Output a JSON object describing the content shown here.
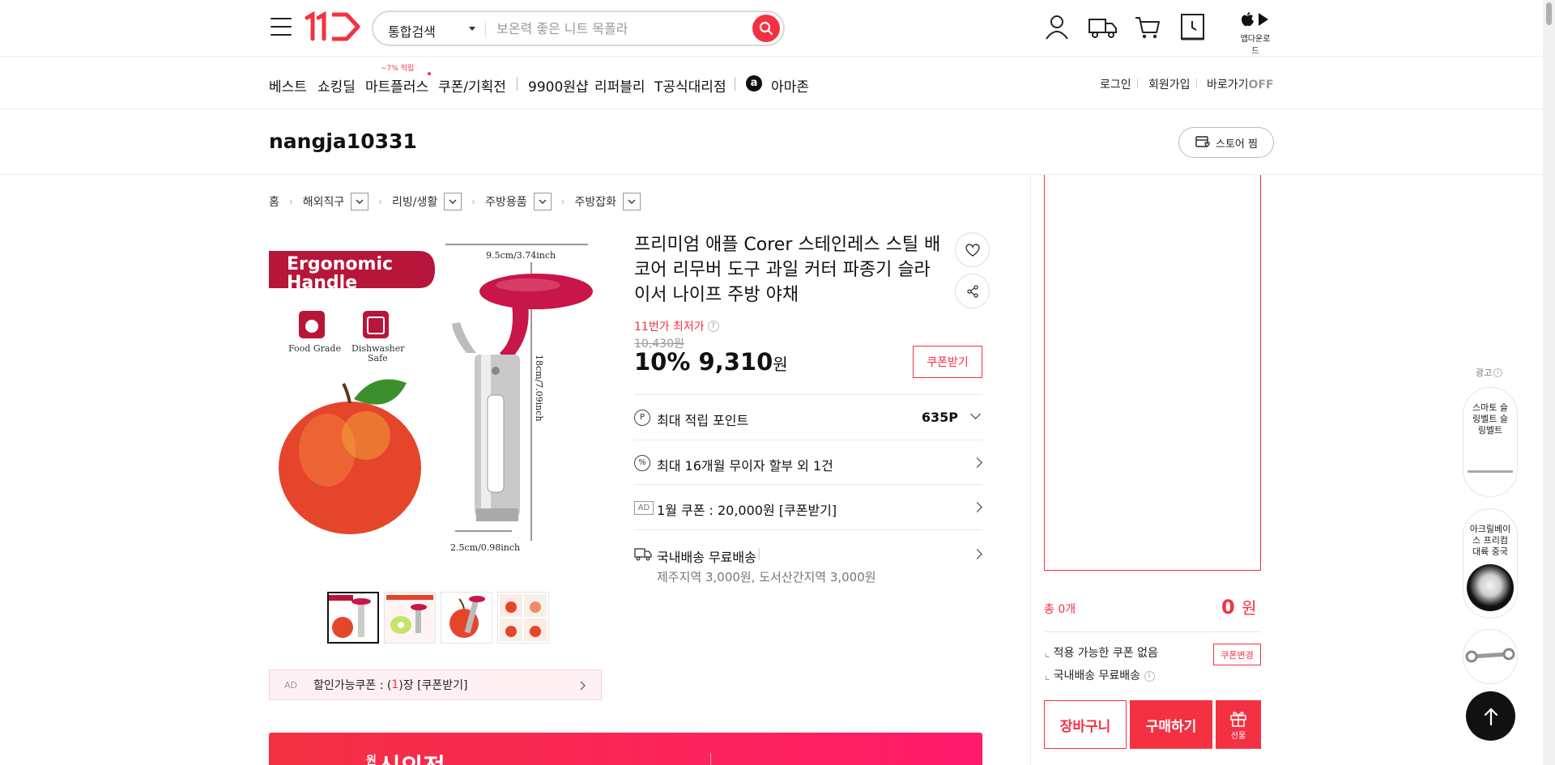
{
  "header": {
    "search_scope": "통합검색",
    "search_placeholder": "보온력 좋은 니트 목폴라",
    "app_download_label": "앱다운로드"
  },
  "nav": {
    "items": [
      "베스트",
      "쇼킹딜",
      "마트플러스",
      "쿠폰/기획전",
      "9900원샵",
      "리퍼블리",
      "T공식대리점",
      "아마존"
    ],
    "mart_badge": "~7% 적립",
    "right": {
      "login": "로그인",
      "signup": "회원가입",
      "shortcut": "바로가기",
      "shortcut_state": "OFF"
    }
  },
  "store": {
    "name": "nangja10331",
    "like_label": "스토어 찜"
  },
  "breadcrumb": [
    "홈",
    "해외직구",
    "리빙/생활",
    "주방용품",
    "주방잡화"
  ],
  "product": {
    "title": "프리미엄 애플 Corer 스테인레스 스틸 배 코어 리무버 도구 과일 커터 파종기 슬라이서 나이프 주방 야채",
    "lowest_label": "11번가 최저가",
    "original_price": "10,430원",
    "discount": "10%",
    "price": "9,310",
    "price_unit": "원",
    "coupon_button": "쿠폰받기",
    "image_text": {
      "headline_1": "Ergonomic",
      "headline_2": "Handle",
      "width": "9.5cm/3.74inch",
      "height": "18cm/7.09inch",
      "blade": "2.5cm/0.98inch",
      "food_grade": "Food Grade",
      "dishwasher_1": "Dishwasher",
      "dishwasher_2": "Safe"
    },
    "image_coupon": {
      "ad": "AD",
      "text_prefix": "할인가능쿠폰 : (",
      "count": "1",
      "text_suffix": ")장 [쿠폰받기]"
    }
  },
  "info_rows": {
    "points_label": "최대 적립 포인트",
    "points_value": "635P",
    "installment": "최대 16개월 무이자 할부 외 1건",
    "ad_tag": "AD",
    "jan_coupon": "1월 쿠폰 : 20,000원 [쿠폰받기]",
    "shipping": "국내배송 무료배송",
    "shipping_sub": "제주지역 3,000원, 도서산간지역 3,000원"
  },
  "banner": {
    "text": "신의정"
  },
  "side_panel": {
    "total_label": "총 0개",
    "total_value": "0",
    "total_unit": "원",
    "coupon_none": "적용 가능한 쿠폰 없음",
    "coupon_change": "쿠폰변경",
    "shipping": "국내배송 무료배송",
    "cart": "장바구니",
    "buy": "구매하기",
    "gift": "선물"
  },
  "floating_ads": {
    "label": "광고",
    "items": [
      "스마토 슬링벨트 슬링벨트",
      "아크릴베이스 프리컴 대륙 중국"
    ]
  },
  "colors": {
    "brand": "#f43142",
    "text": "#111111",
    "muted": "#999999"
  }
}
